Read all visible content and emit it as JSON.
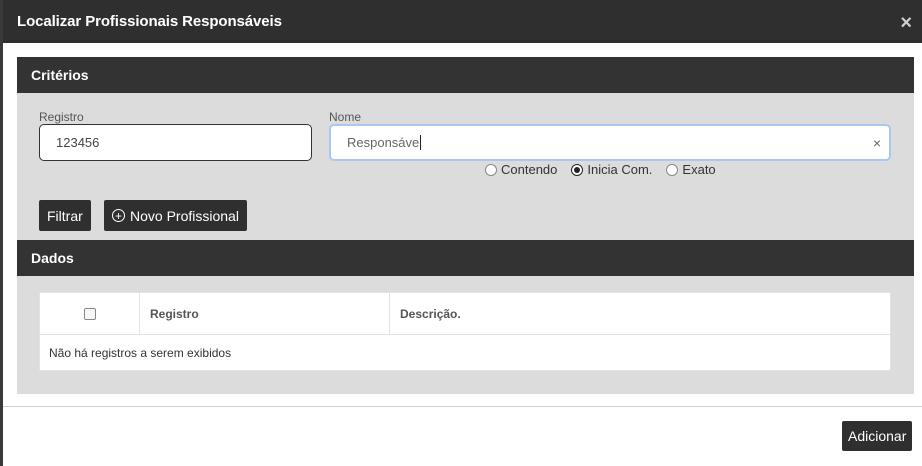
{
  "modal": {
    "title": "Localizar Profissionais Responsáveis",
    "close_symbol": "×"
  },
  "criteria": {
    "heading": "Critérios",
    "registro": {
      "label": "Registro",
      "value": "123456"
    },
    "nome": {
      "label": "Nome",
      "value": "Responsáve",
      "clear_symbol": "×"
    },
    "match_options": [
      {
        "label": "Contendo",
        "checked": false
      },
      {
        "label": "Inicia Com.",
        "checked": true
      },
      {
        "label": "Exato",
        "checked": false
      }
    ],
    "filter_button": "Filtrar",
    "new_button": "Novo Profissional",
    "new_button_icon": "plus-circle-icon"
  },
  "dados": {
    "heading": "Dados",
    "columns": [
      "Registro",
      "Descrição."
    ],
    "empty_message": "Não há registros a serem exibidos"
  },
  "footer": {
    "add_button": "Adicionar"
  }
}
